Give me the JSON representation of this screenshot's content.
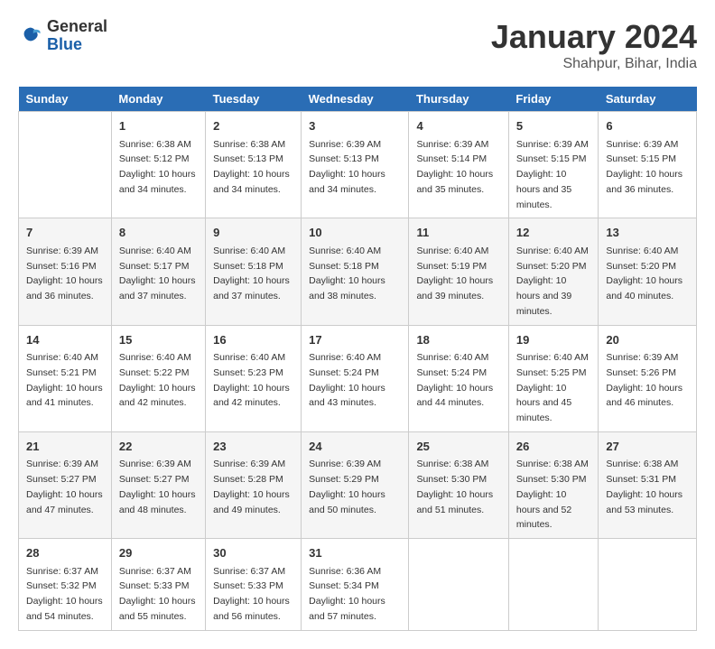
{
  "header": {
    "logo_general": "General",
    "logo_blue": "Blue",
    "main_title": "January 2024",
    "subtitle": "Shahpur, Bihar, India"
  },
  "calendar": {
    "days_of_week": [
      "Sunday",
      "Monday",
      "Tuesday",
      "Wednesday",
      "Thursday",
      "Friday",
      "Saturday"
    ],
    "weeks": [
      [
        {
          "day": "",
          "sunrise": "",
          "sunset": "",
          "daylight": ""
        },
        {
          "day": "1",
          "sunrise": "Sunrise: 6:38 AM",
          "sunset": "Sunset: 5:12 PM",
          "daylight": "Daylight: 10 hours and 34 minutes."
        },
        {
          "day": "2",
          "sunrise": "Sunrise: 6:38 AM",
          "sunset": "Sunset: 5:13 PM",
          "daylight": "Daylight: 10 hours and 34 minutes."
        },
        {
          "day": "3",
          "sunrise": "Sunrise: 6:39 AM",
          "sunset": "Sunset: 5:13 PM",
          "daylight": "Daylight: 10 hours and 34 minutes."
        },
        {
          "day": "4",
          "sunrise": "Sunrise: 6:39 AM",
          "sunset": "Sunset: 5:14 PM",
          "daylight": "Daylight: 10 hours and 35 minutes."
        },
        {
          "day": "5",
          "sunrise": "Sunrise: 6:39 AM",
          "sunset": "Sunset: 5:15 PM",
          "daylight": "Daylight: 10 hours and 35 minutes."
        },
        {
          "day": "6",
          "sunrise": "Sunrise: 6:39 AM",
          "sunset": "Sunset: 5:15 PM",
          "daylight": "Daylight: 10 hours and 36 minutes."
        }
      ],
      [
        {
          "day": "7",
          "sunrise": "Sunrise: 6:39 AM",
          "sunset": "Sunset: 5:16 PM",
          "daylight": "Daylight: 10 hours and 36 minutes."
        },
        {
          "day": "8",
          "sunrise": "Sunrise: 6:40 AM",
          "sunset": "Sunset: 5:17 PM",
          "daylight": "Daylight: 10 hours and 37 minutes."
        },
        {
          "day": "9",
          "sunrise": "Sunrise: 6:40 AM",
          "sunset": "Sunset: 5:18 PM",
          "daylight": "Daylight: 10 hours and 37 minutes."
        },
        {
          "day": "10",
          "sunrise": "Sunrise: 6:40 AM",
          "sunset": "Sunset: 5:18 PM",
          "daylight": "Daylight: 10 hours and 38 minutes."
        },
        {
          "day": "11",
          "sunrise": "Sunrise: 6:40 AM",
          "sunset": "Sunset: 5:19 PM",
          "daylight": "Daylight: 10 hours and 39 minutes."
        },
        {
          "day": "12",
          "sunrise": "Sunrise: 6:40 AM",
          "sunset": "Sunset: 5:20 PM",
          "daylight": "Daylight: 10 hours and 39 minutes."
        },
        {
          "day": "13",
          "sunrise": "Sunrise: 6:40 AM",
          "sunset": "Sunset: 5:20 PM",
          "daylight": "Daylight: 10 hours and 40 minutes."
        }
      ],
      [
        {
          "day": "14",
          "sunrise": "Sunrise: 6:40 AM",
          "sunset": "Sunset: 5:21 PM",
          "daylight": "Daylight: 10 hours and 41 minutes."
        },
        {
          "day": "15",
          "sunrise": "Sunrise: 6:40 AM",
          "sunset": "Sunset: 5:22 PM",
          "daylight": "Daylight: 10 hours and 42 minutes."
        },
        {
          "day": "16",
          "sunrise": "Sunrise: 6:40 AM",
          "sunset": "Sunset: 5:23 PM",
          "daylight": "Daylight: 10 hours and 42 minutes."
        },
        {
          "day": "17",
          "sunrise": "Sunrise: 6:40 AM",
          "sunset": "Sunset: 5:24 PM",
          "daylight": "Daylight: 10 hours and 43 minutes."
        },
        {
          "day": "18",
          "sunrise": "Sunrise: 6:40 AM",
          "sunset": "Sunset: 5:24 PM",
          "daylight": "Daylight: 10 hours and 44 minutes."
        },
        {
          "day": "19",
          "sunrise": "Sunrise: 6:40 AM",
          "sunset": "Sunset: 5:25 PM",
          "daylight": "Daylight: 10 hours and 45 minutes."
        },
        {
          "day": "20",
          "sunrise": "Sunrise: 6:39 AM",
          "sunset": "Sunset: 5:26 PM",
          "daylight": "Daylight: 10 hours and 46 minutes."
        }
      ],
      [
        {
          "day": "21",
          "sunrise": "Sunrise: 6:39 AM",
          "sunset": "Sunset: 5:27 PM",
          "daylight": "Daylight: 10 hours and 47 minutes."
        },
        {
          "day": "22",
          "sunrise": "Sunrise: 6:39 AM",
          "sunset": "Sunset: 5:27 PM",
          "daylight": "Daylight: 10 hours and 48 minutes."
        },
        {
          "day": "23",
          "sunrise": "Sunrise: 6:39 AM",
          "sunset": "Sunset: 5:28 PM",
          "daylight": "Daylight: 10 hours and 49 minutes."
        },
        {
          "day": "24",
          "sunrise": "Sunrise: 6:39 AM",
          "sunset": "Sunset: 5:29 PM",
          "daylight": "Daylight: 10 hours and 50 minutes."
        },
        {
          "day": "25",
          "sunrise": "Sunrise: 6:38 AM",
          "sunset": "Sunset: 5:30 PM",
          "daylight": "Daylight: 10 hours and 51 minutes."
        },
        {
          "day": "26",
          "sunrise": "Sunrise: 6:38 AM",
          "sunset": "Sunset: 5:30 PM",
          "daylight": "Daylight: 10 hours and 52 minutes."
        },
        {
          "day": "27",
          "sunrise": "Sunrise: 6:38 AM",
          "sunset": "Sunset: 5:31 PM",
          "daylight": "Daylight: 10 hours and 53 minutes."
        }
      ],
      [
        {
          "day": "28",
          "sunrise": "Sunrise: 6:37 AM",
          "sunset": "Sunset: 5:32 PM",
          "daylight": "Daylight: 10 hours and 54 minutes."
        },
        {
          "day": "29",
          "sunrise": "Sunrise: 6:37 AM",
          "sunset": "Sunset: 5:33 PM",
          "daylight": "Daylight: 10 hours and 55 minutes."
        },
        {
          "day": "30",
          "sunrise": "Sunrise: 6:37 AM",
          "sunset": "Sunset: 5:33 PM",
          "daylight": "Daylight: 10 hours and 56 minutes."
        },
        {
          "day": "31",
          "sunrise": "Sunrise: 6:36 AM",
          "sunset": "Sunset: 5:34 PM",
          "daylight": "Daylight: 10 hours and 57 minutes."
        },
        {
          "day": "",
          "sunrise": "",
          "sunset": "",
          "daylight": ""
        },
        {
          "day": "",
          "sunrise": "",
          "sunset": "",
          "daylight": ""
        },
        {
          "day": "",
          "sunrise": "",
          "sunset": "",
          "daylight": ""
        }
      ]
    ]
  }
}
